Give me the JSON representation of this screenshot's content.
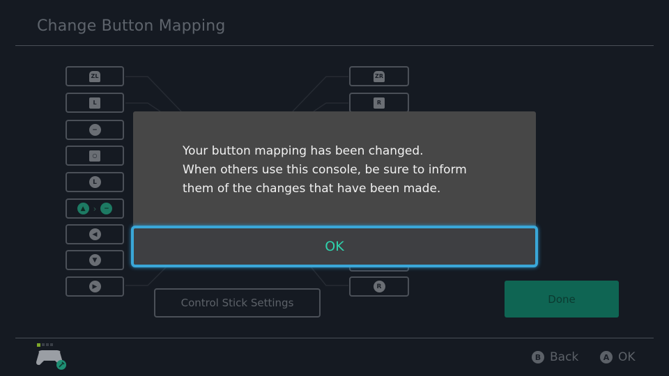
{
  "header": {
    "title": "Change Button Mapping"
  },
  "left_keys": [
    {
      "label": "ZL",
      "icon": "zl-trigger-icon",
      "shape": "tab"
    },
    {
      "label": "L",
      "icon": "l-bumper-icon",
      "shape": "sq"
    },
    {
      "label": "−",
      "icon": "minus-button-icon",
      "shape": "circ"
    },
    {
      "label": "○",
      "icon": "capture-button-icon",
      "shape": "sq"
    },
    {
      "label": "L",
      "icon": "left-stick-press-icon",
      "shape": "circ"
    },
    {
      "label_from": "▲",
      "label_to": "−",
      "separator": "›",
      "icon_from": "up-button-icon",
      "icon_to": "minus-button-icon",
      "remapped": true
    },
    {
      "label": "◀",
      "icon": "left-button-icon",
      "shape": "circ"
    },
    {
      "label": "▼",
      "icon": "down-button-icon",
      "shape": "circ"
    },
    {
      "label": "▶",
      "icon": "right-button-icon",
      "shape": "circ"
    }
  ],
  "right_keys": [
    {
      "label": "ZR",
      "icon": "zr-trigger-icon",
      "shape": "tab"
    },
    {
      "label": "R",
      "icon": "r-bumper-icon",
      "shape": "sq"
    },
    {
      "label": "R",
      "icon": "right-stick-press-icon",
      "shape": "circ"
    }
  ],
  "control_stick_button": "Control Stick Settings",
  "done_button": "Done",
  "dialog": {
    "message_lines": [
      "Your button mapping has been changed.",
      "When others use this console, be sure to inform",
      "them of the changes that have been made."
    ],
    "ok_label": "OK"
  },
  "footer": {
    "player_indicator": "1",
    "hints": [
      {
        "badge": "B",
        "label": "Back"
      },
      {
        "badge": "A",
        "label": "OK"
      }
    ]
  },
  "colors": {
    "accent_teal": "#2fd3ad",
    "focus_blue": "#3aa7d8",
    "done_green": "#0f6553"
  }
}
